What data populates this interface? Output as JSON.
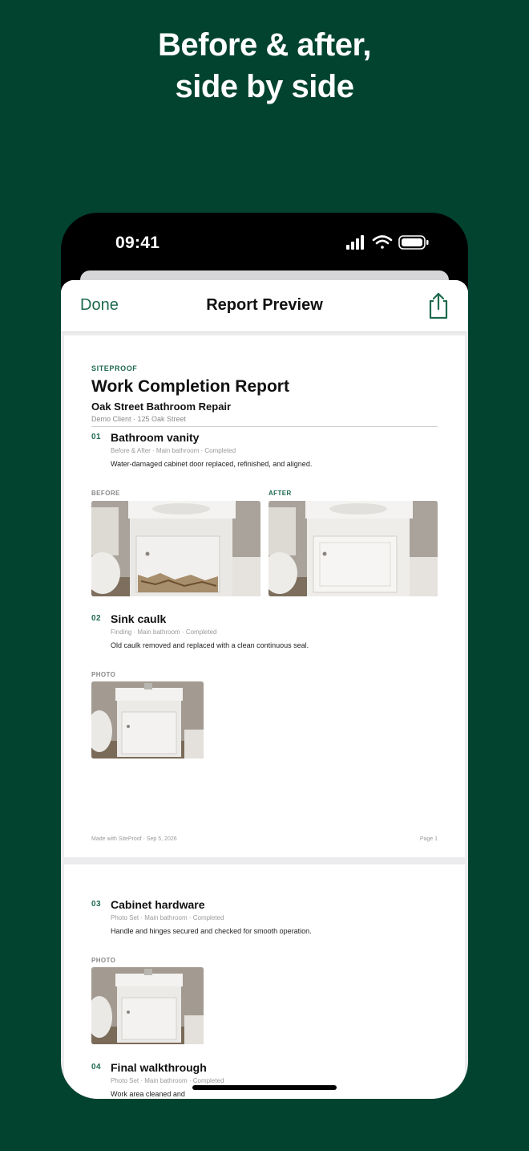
{
  "headline": {
    "line1": "Before & after,",
    "line2": "side by side"
  },
  "status_bar": {
    "time": "09:41"
  },
  "nav": {
    "done_label": "Done",
    "title": "Report Preview"
  },
  "report": {
    "brand": "SITEPROOF",
    "title": "Work Completion Report",
    "project": "Oak Street Bathroom Repair",
    "client_line": "Demo Client · 125 Oak Street",
    "items": [
      {
        "number": "01",
        "title": "Bathroom vanity",
        "meta": "Before & After · Main bathroom · Completed",
        "description": "Water-damaged cabinet door replaced, refinished, and aligned.",
        "photo_labels": [
          "BEFORE",
          "AFTER"
        ]
      },
      {
        "number": "02",
        "title": "Sink caulk",
        "meta": "Finding · Main bathroom · Completed",
        "description": "Old caulk removed and replaced with a clean continuous seal.",
        "photo_labels": [
          "PHOTO"
        ]
      },
      {
        "number": "03",
        "title": "Cabinet hardware",
        "meta": "Photo Set · Main bathroom · Completed",
        "description": "Handle and hinges secured and checked for smooth operation.",
        "photo_labels": [
          "PHOTO"
        ]
      },
      {
        "number": "04",
        "title": "Final walkthrough",
        "meta": "Photo Set · Main bathroom · Completed",
        "description": "Work area cleaned and"
      }
    ],
    "footer": {
      "made_with": "Made with SiteProof · Sep 5, 2026",
      "page": "Page 1"
    }
  },
  "colors": {
    "brand_green": "#1e6a4d",
    "background": "#02432f"
  }
}
